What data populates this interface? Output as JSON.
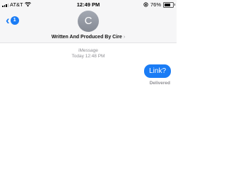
{
  "status_bar": {
    "carrier": "AT&T",
    "time": "12:49 PM",
    "battery_text": "76%",
    "battery_level": 0.76
  },
  "header": {
    "unread_count": "1",
    "avatar_initial": "C",
    "contact_name": "Written And Produced By Cire",
    "chevron": "›"
  },
  "thread": {
    "service": "iMessage",
    "timestamp": "Today 12:48 PM",
    "messages": [
      {
        "text": "Link?",
        "sender": "me",
        "status": "Delivered"
      }
    ]
  },
  "colors": {
    "accent": "#1a7cf5",
    "bar_background": "#f6f6f7",
    "meta_text": "#8e8e93"
  },
  "icons": [
    "signal-bars-icon",
    "wifi-icon",
    "lock-rotation-icon",
    "battery-icon",
    "back-chevron-icon",
    "chevron-right-icon"
  ]
}
